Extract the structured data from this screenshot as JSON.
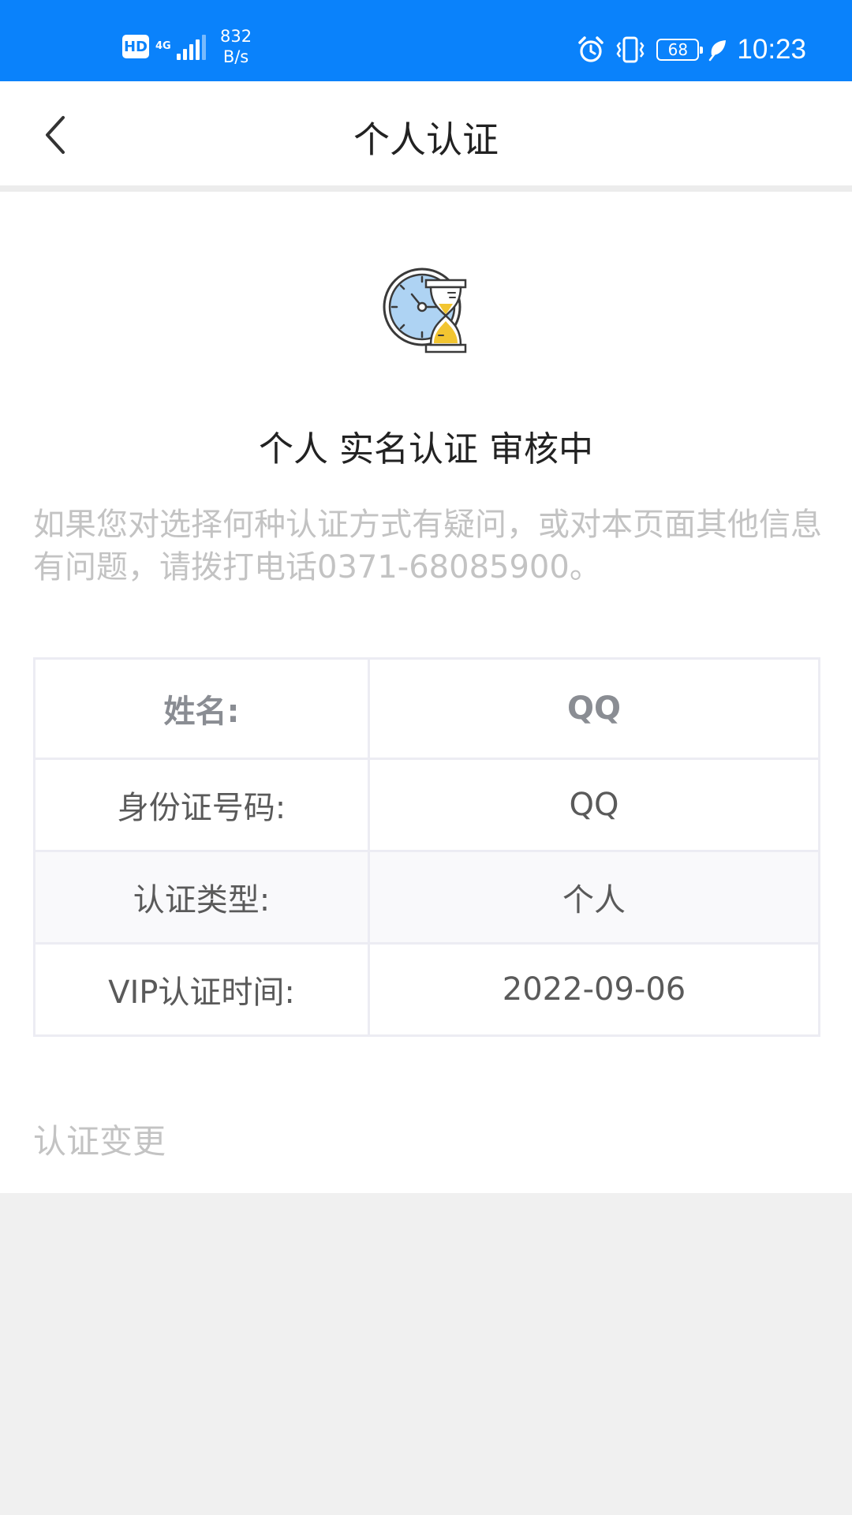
{
  "status_bar": {
    "hd_label": "HD",
    "network_type": "4G",
    "network_speed_value": "832",
    "network_speed_unit": "B/s",
    "battery_level": "68",
    "time": "10:23",
    "background_color": "#0a82fb",
    "icons": [
      "alarm-icon",
      "vibrate-icon",
      "battery-icon",
      "leaf-icon"
    ]
  },
  "nav": {
    "title": "个人认证",
    "back_icon": "chevron-left-icon"
  },
  "audit": {
    "icon": "clock-hourglass-icon",
    "title": "个人 实名认证 审核中",
    "hint": "如果您对选择何种认证方式有疑问，或对本页面其他信息有问题，请拨打电话0371-68085900。"
  },
  "info_table": {
    "rows": [
      {
        "label": "姓名:",
        "value": "QQ"
      },
      {
        "label": "身份证号码:",
        "value": "QQ"
      },
      {
        "label": "认证类型:",
        "value": "个人"
      },
      {
        "label": "VIP认证时间:",
        "value": "2022-09-06"
      }
    ]
  },
  "actions": {
    "change_label": "认证变更"
  }
}
